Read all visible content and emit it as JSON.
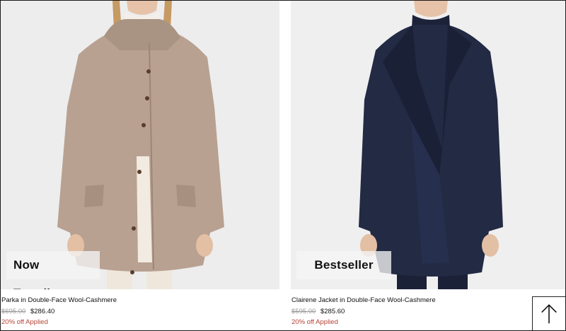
{
  "products": [
    {
      "badge": "Now Trending",
      "name": "Parka in Double-Face Wool-Cashmere",
      "original_price": "$695.00",
      "sale_price": "$286.40",
      "promo": "20% off Applied",
      "image": "beige-wool-parka-photo"
    },
    {
      "badge": "Bestseller",
      "name": "Clairene Jacket in Double-Face Wool-Cashmere",
      "original_price": "$595.00",
      "sale_price": "$285.60",
      "promo": "20% off Applied",
      "image": "navy-wool-jacket-photo"
    }
  ],
  "scroll_top_button": {
    "icon": "arrow-up-icon"
  },
  "colors": {
    "promo": "#b44335",
    "strike_price": "#9a9a9a",
    "badge_bg": "#f5f5f5",
    "image_bg": "#ececec"
  }
}
